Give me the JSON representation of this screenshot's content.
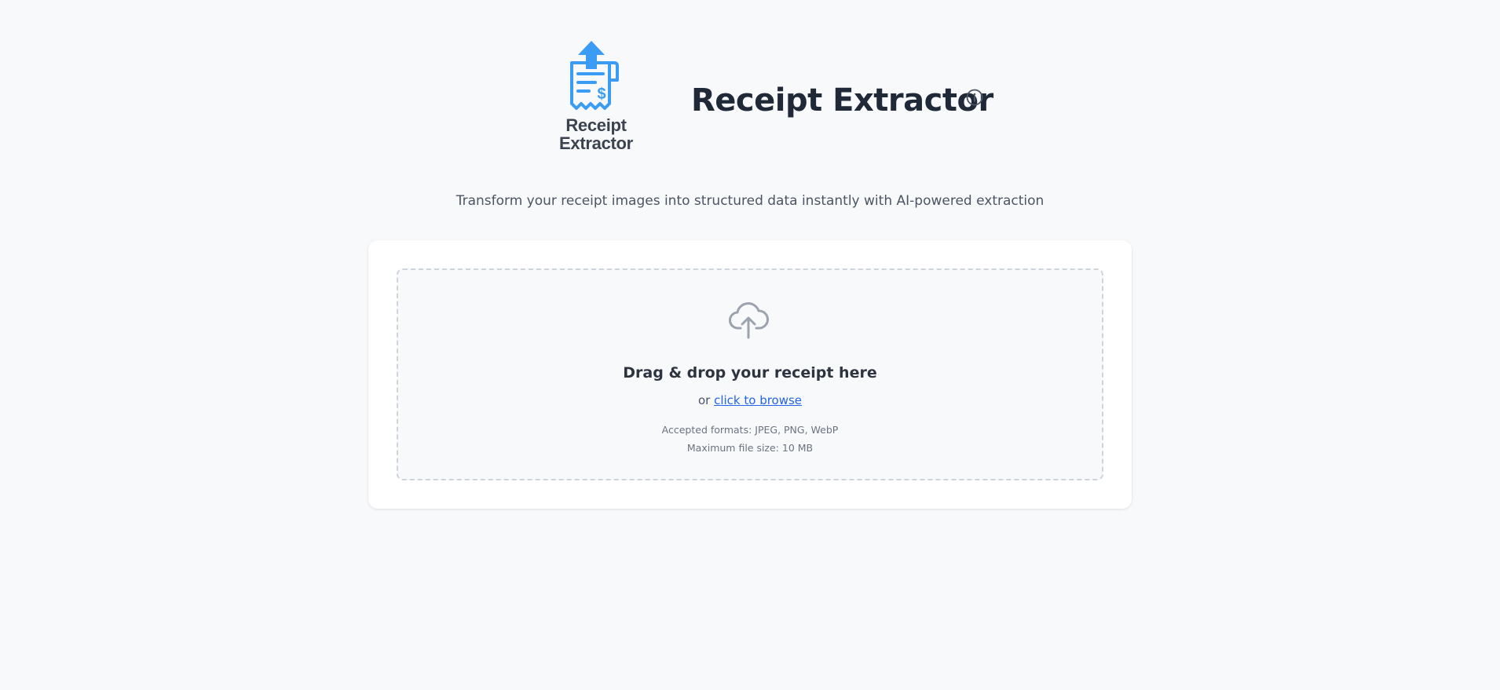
{
  "header": {
    "logo_line1": "Receipt",
    "logo_line2": "Extractor",
    "title": "Receipt Extractor",
    "info_icon": "info-icon"
  },
  "subtitle": "Transform your receipt images into structured data instantly with AI-powered extraction",
  "upload": {
    "icon": "cloud-upload-icon",
    "title": "Drag & drop your receipt here",
    "or_text": "or",
    "browse_link": "click to browse",
    "accepted_formats": "Accepted formats: JPEG, PNG, WebP",
    "max_size": "Maximum file size: 10 MB"
  },
  "colors": {
    "brand_blue": "#3b9cf5",
    "link_blue": "#2563eb",
    "background": "#f8f9fb"
  }
}
